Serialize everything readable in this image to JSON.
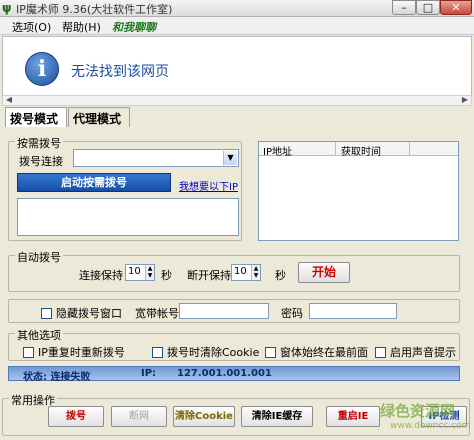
{
  "window": {
    "title": "IP魔术师 9.36(大壮软件工作室)",
    "minimize": "–",
    "maximize": "□",
    "close": "✕"
  },
  "menu": {
    "options": "选项(O)",
    "help": "帮助(H)",
    "forum": "和我聊聊"
  },
  "browser": {
    "error_text": "无法找到该网页"
  },
  "tabs": {
    "dial_mode": "拨号模式",
    "proxy_mode": "代理模式"
  },
  "dial_group": {
    "title": "按需拨号",
    "connection_label": "拨号连接",
    "connection_value": "",
    "start_button": "启动按需拨号",
    "help_link": "我想要以下IP"
  },
  "ip_table": {
    "columns": [
      "IP地址",
      "获取时间"
    ],
    "rows": []
  },
  "auto_dial": {
    "title": "自动拨号",
    "keep_label": "连接保持",
    "keep_value": "10",
    "keep_unit": "秒",
    "disconnect_label": "断开保持",
    "disconnect_value": "10",
    "disconnect_unit": "秒",
    "start_button": "开始"
  },
  "hide_group": {
    "hide_window_label": "隐藏拨号窗口",
    "account_label": "宽带帐号",
    "account_value": "",
    "password_label": "密码",
    "password_value": ""
  },
  "other_options": {
    "title": "其他选项",
    "opt1": "IP重复时重新拨号",
    "opt2": "拨号时清除Cookie",
    "opt3": "窗体始终在最前面",
    "opt4": "启用声音提示"
  },
  "status": {
    "state_label": "状态: 连接失败",
    "ip_label": "IP:",
    "ip_value": "127.001.001.001"
  },
  "operations": {
    "title": "常用操作",
    "dial": "拨号",
    "hangup": "断网",
    "clear_cookie": "清除Cookie",
    "reset_ie": "清除IE缓存",
    "restart_ie": "重启IE",
    "ip_check": "IP检测"
  },
  "watermark": {
    "brand": "绿色资源网",
    "url": "www.downcc.com"
  }
}
